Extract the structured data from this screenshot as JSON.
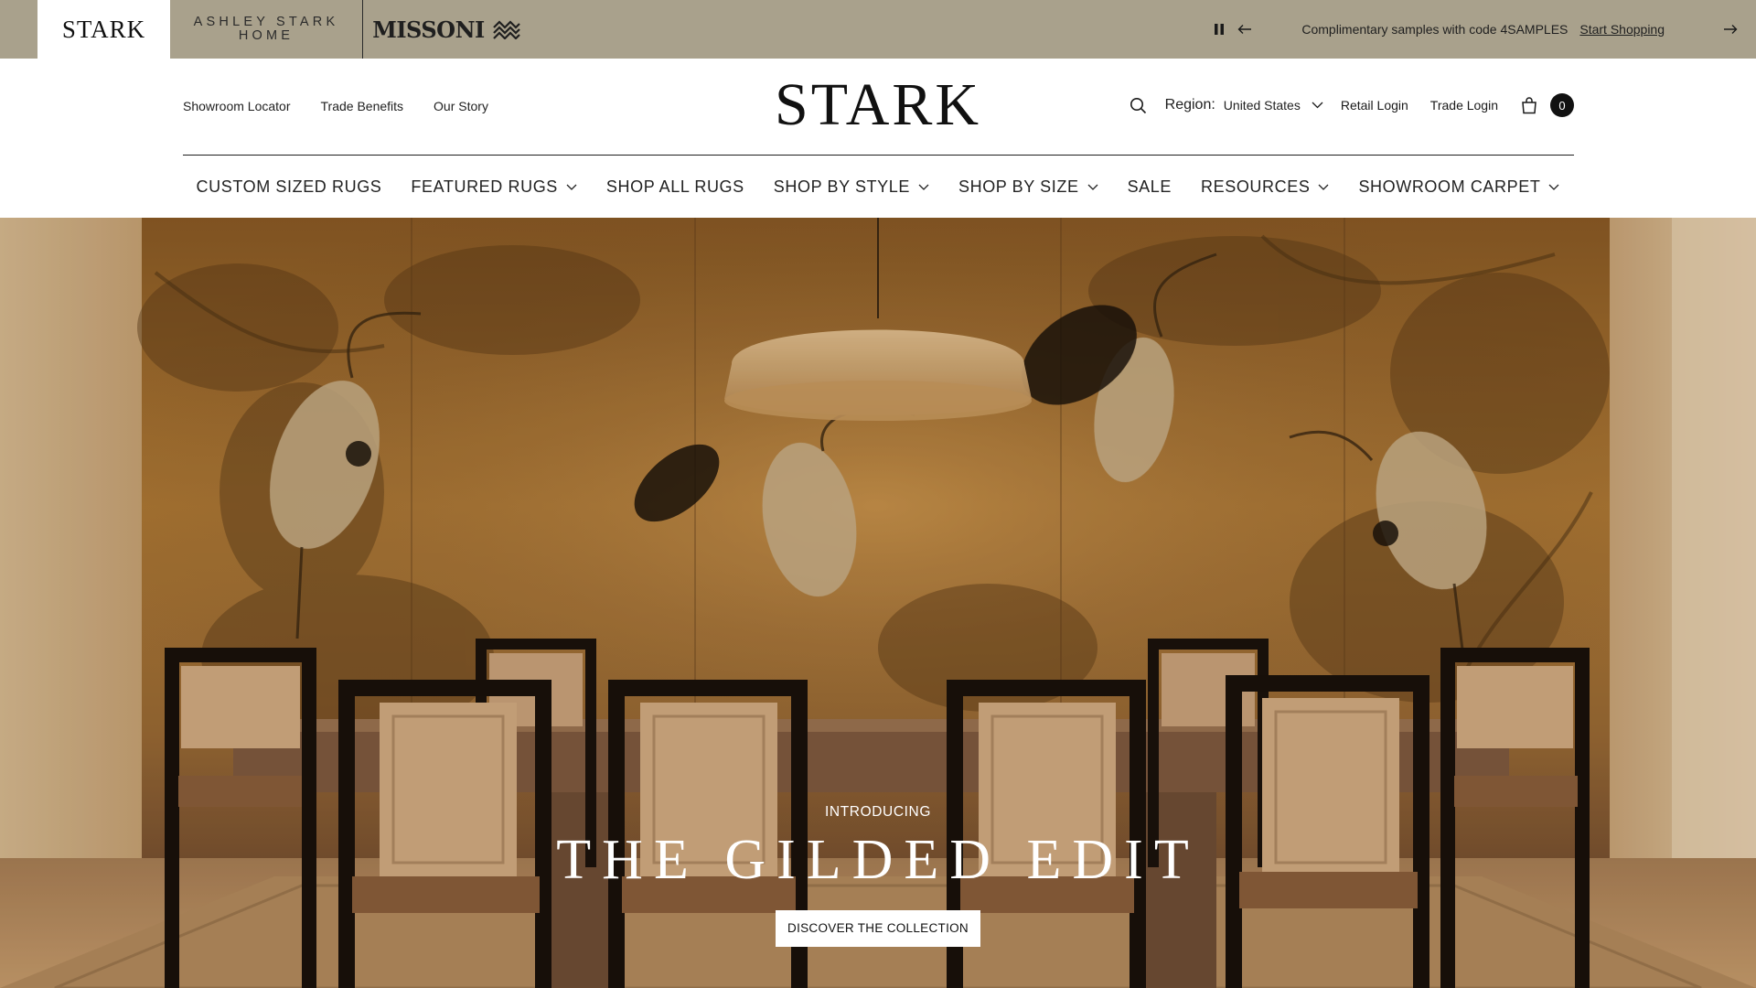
{
  "brandbar": {
    "brands": {
      "stark": "STARK",
      "ashley_line1": "ASHLEY STARK",
      "ashley_line2": "HOME",
      "missoni": "MISSONI"
    },
    "promo_text": "Complimentary samples with code 4SAMPLES",
    "promo_link": "Start Shopping",
    "background": "#a9a18c"
  },
  "header": {
    "utility_left": [
      "Showroom Locator",
      "Trade Benefits",
      "Our Story"
    ],
    "logo": "STARK",
    "region_label": "Region:",
    "region_value": "United States",
    "retail_login": "Retail Login",
    "trade_login": "Trade Login",
    "cart_count": "0"
  },
  "nav": {
    "items": [
      {
        "label": "CUSTOM SIZED RUGS",
        "dropdown": false
      },
      {
        "label": "FEATURED RUGS",
        "dropdown": true
      },
      {
        "label": "SHOP ALL RUGS",
        "dropdown": false
      },
      {
        "label": "SHOP BY STYLE",
        "dropdown": true
      },
      {
        "label": "SHOP BY SIZE",
        "dropdown": true
      },
      {
        "label": "SALE",
        "dropdown": false
      },
      {
        "label": "RESOURCES",
        "dropdown": true
      },
      {
        "label": "SHOWROOM CARPET",
        "dropdown": true
      }
    ]
  },
  "hero": {
    "kicker": "INTRODUCING",
    "title": "THE GILDED EDIT",
    "cta": "DISCOVER THE COLLECTION"
  },
  "icons": {
    "pause": "pause-icon",
    "prev": "arrow-left-icon",
    "next": "arrow-right-icon",
    "search": "search-icon",
    "chevron": "chevron-down-icon",
    "cart": "shopping-bag-icon",
    "missoni_mark": "zigzag-logo-icon"
  }
}
